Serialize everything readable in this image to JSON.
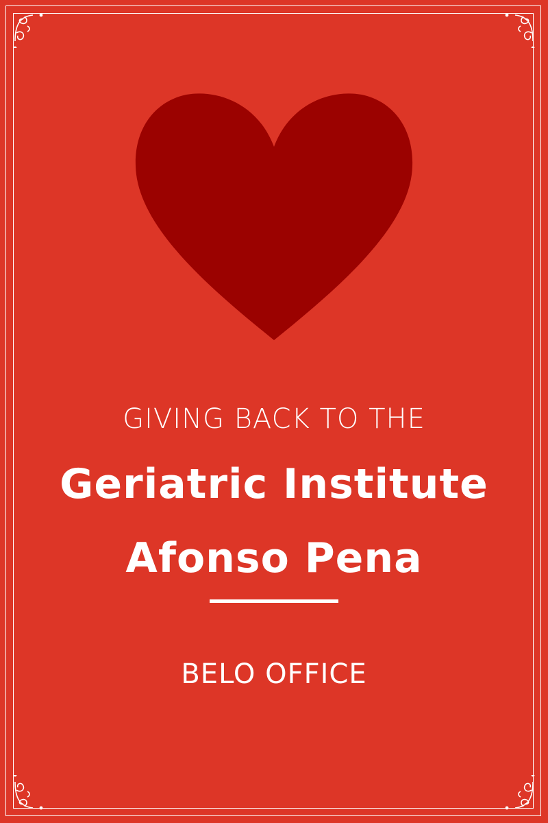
{
  "poster": {
    "subtitle": "GIVING BACK TO THE",
    "title_line1": "Geriatric Institute",
    "title_line2": "Afonso Pena",
    "office": "Belo office"
  },
  "colors": {
    "background": "#dd3627",
    "heart": "#9b0200",
    "text": "#ffffff"
  },
  "icons": [
    "heart-icon",
    "corner-flourish-icon"
  ]
}
